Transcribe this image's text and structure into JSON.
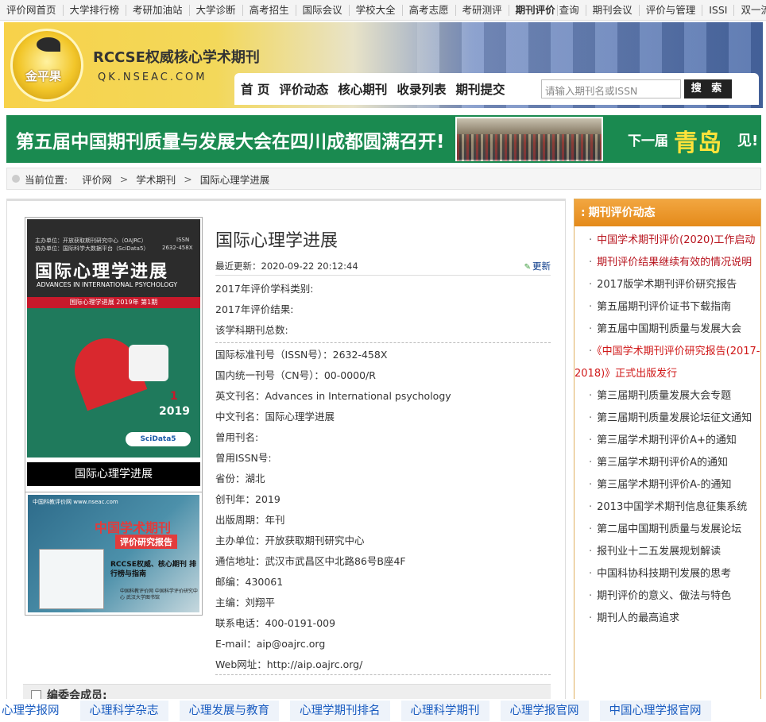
{
  "topnav": [
    "评价网首页",
    "大学排行榜",
    "考研加油站",
    "大学诊断",
    "高考招生",
    "国际会议",
    "学校大全",
    "高考志愿",
    "考研测评",
    "期刊评价",
    "查询",
    "期刊会议",
    "评价与管理",
    "ISSI",
    "双一流"
  ],
  "header": {
    "logo_text": "金平果",
    "site_title": "RCCSE权威核心学术期刊",
    "site_domain": "QK.NSEAC.COM"
  },
  "mainnav": {
    "items": [
      "首 页",
      "评价动态",
      "核心期刊",
      "收录列表",
      "期刊提交"
    ],
    "search_placeholder": "请输入期刊名或ISSN",
    "search_button": "搜 索"
  },
  "banner": {
    "text1": "第五届中国期刊质量与发展大会在四川成都圆满召开!",
    "text2": "下一届",
    "text3": "青岛",
    "text4": "见!"
  },
  "breadcrumb": {
    "label": "当前位置:",
    "items": [
      "评价网",
      "学术期刊",
      "国际心理学进展"
    ]
  },
  "cover": {
    "sponsor1": "主办单位：开放获取期刊研究中心（OAJRC）",
    "sponsor2": "协办单位：国际科学大数据平台（SciData5）",
    "issn_label": "ISSN",
    "issn": "2632-458X",
    "title": "国际心理学进展",
    "title_en": "ADVANCES IN INTERNATIONAL PSYCHOLOGY",
    "issue_bar": "国际心理学进展  2019年  第1期",
    "num": "1",
    "year": "2019",
    "badge": "SciData5",
    "caption": "国际心理学进展"
  },
  "ad": {
    "l1": "中国科教评价网 www.nseac.com",
    "l2": "中国学术期刊",
    "l3": "评价研究报告",
    "l4": "RCCSE权威、核心期刊 排行榜与指南",
    "l5": "中国科教评价网 中国科学评价研究中心 武汉大学图书馆"
  },
  "journal": {
    "title": "国际心理学进展",
    "update_label": "最近更新：2020-09-22 20:12:44",
    "update_link": "更新",
    "group1": [
      "2017年评价学科类别:",
      "2017年评价结果:",
      "该学科期刊总数:"
    ],
    "fields": [
      "国际标准刊号（ISSN号）：2632-458X",
      "国内统一刊号（CN号）：00-0000/R",
      "英文刊名：Advances in International psychology",
      "中文刊名：国际心理学进展",
      "曾用刊名:",
      "曾用ISSN号:",
      "省份：湖北",
      "创刊年：2019",
      "出版周期：年刊",
      "主办单位：开放获取期刊研究中心",
      "通信地址：武汉市武昌区中北路86号B座4F",
      "邮编：430061",
      "主编：刘翔平",
      "联系电话：400-0191-009",
      "E-mail：aip@oajrc.org",
      "Web网址：http://aip.oajrc.org/"
    ],
    "editorial_label": "编委会成员:"
  },
  "sidebar": {
    "title": "期刊评价动态",
    "items": [
      {
        "text": "中国学术期刊评价(2020)工作启动",
        "cls": "wrap red2"
      },
      {
        "text": "期刊评价结果继续有效的情况说明",
        "cls": "wrap red2"
      },
      {
        "text": "2017版学术期刊评价研究报告",
        "cls": ""
      },
      {
        "text": "第五届期刊评价证书下载指南",
        "cls": ""
      },
      {
        "text": "第五届中国期刊质量与发展大会",
        "cls": ""
      },
      {
        "text": "《中国学术期刊评价研究报告(2017-2018)》正式出版发行",
        "cls": "wrap red"
      },
      {
        "text": "第三届期刊质量发展大会专题",
        "cls": ""
      },
      {
        "text": "第三届期刊质量发展论坛征文通知",
        "cls": "wrap"
      },
      {
        "text": "第三届学术期刊评价A+的通知",
        "cls": ""
      },
      {
        "text": "第三届学术期刊评价A的通知",
        "cls": ""
      },
      {
        "text": "第三届学术期刊评价A-的通知",
        "cls": ""
      },
      {
        "text": "2013中国学术期刊信息征集系统",
        "cls": ""
      },
      {
        "text": "第二届中国期刊质量与发展论坛",
        "cls": ""
      },
      {
        "text": "报刊业十二五发展规划解读",
        "cls": ""
      },
      {
        "text": "中国科协科技期刊发展的思考",
        "cls": ""
      },
      {
        "text": "期刊评价的意义、做法与特色",
        "cls": ""
      },
      {
        "text": "期刊人的最高追求",
        "cls": ""
      }
    ]
  },
  "bottombar": [
    "心理学报网",
    "心理科学杂志",
    "心理发展与教育",
    "心理学期刊排名",
    "心理科学期刊",
    "心理学报官网",
    "中国心理学报官网"
  ]
}
